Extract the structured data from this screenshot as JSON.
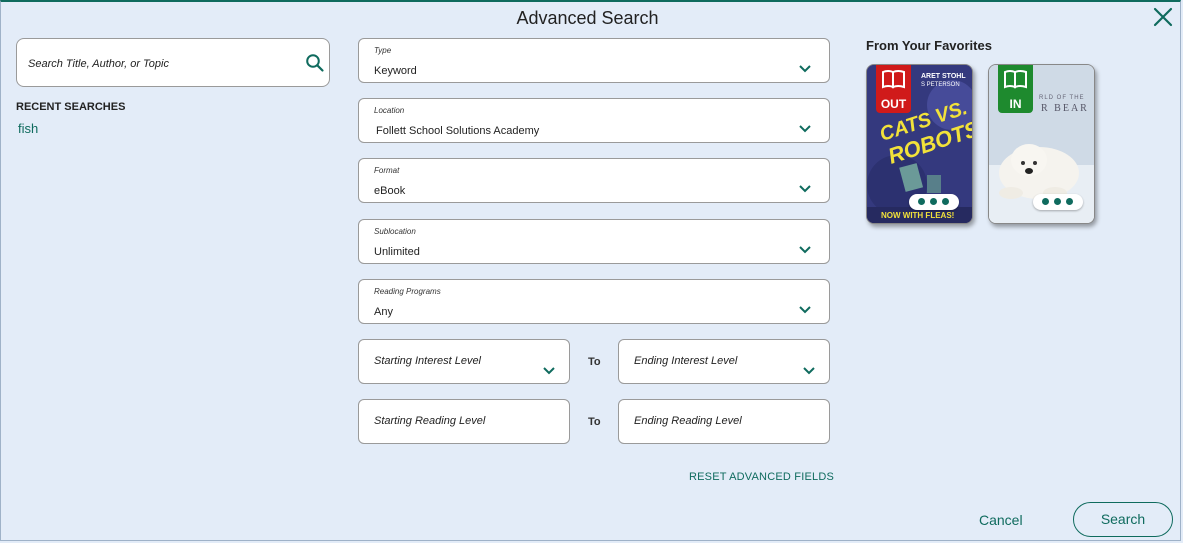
{
  "dialog": {
    "title": "Advanced Search"
  },
  "search": {
    "placeholder": "Search Title, Author, or Topic",
    "value": ""
  },
  "recent": {
    "title": "RECENT SEARCHES",
    "items": [
      "fish"
    ]
  },
  "fields": {
    "type": {
      "label": "Type",
      "value": "Keyword"
    },
    "location": {
      "label": "Location",
      "value": "Follett School Solutions Academy"
    },
    "format": {
      "label": "Format",
      "value": "eBook"
    },
    "sublocation": {
      "label": "Sublocation",
      "value": "Unlimited"
    },
    "reading_programs": {
      "label": "Reading Programs",
      "value": "Any"
    },
    "starting_interest": {
      "placeholder": "Starting Interest Level"
    },
    "ending_interest": {
      "placeholder": "Ending Interest Level"
    },
    "starting_reading": {
      "placeholder": "Starting Reading Level"
    },
    "ending_reading": {
      "placeholder": "Ending Reading Level"
    },
    "to_label": "To"
  },
  "actions": {
    "reset": "RESET ADVANCED FIELDS",
    "cancel": "Cancel",
    "search": "Search"
  },
  "favorites": {
    "title": "From Your Favorites",
    "books": [
      {
        "status": "OUT",
        "status_color": "#d01a1a",
        "cover_author": "ARET STOHL",
        "cover_author2": "S PETERSON",
        "cover_title_line1": "CATS VS.",
        "cover_title_line2": "ROBOTS",
        "cover_tagline": "NOW WITH FLEAS!"
      },
      {
        "status": "IN",
        "status_color": "#1e8a2e",
        "cover_title_small": "RLD OF THE",
        "cover_title_large": "R BEAR"
      }
    ]
  },
  "colors": {
    "accent": "#0f6b5e",
    "background": "#e3ecf8"
  },
  "icons": {
    "close": "close-icon",
    "search": "search-icon",
    "chevron": "chevron-down-icon",
    "book": "book-icon",
    "more": "more-dots-icon"
  }
}
